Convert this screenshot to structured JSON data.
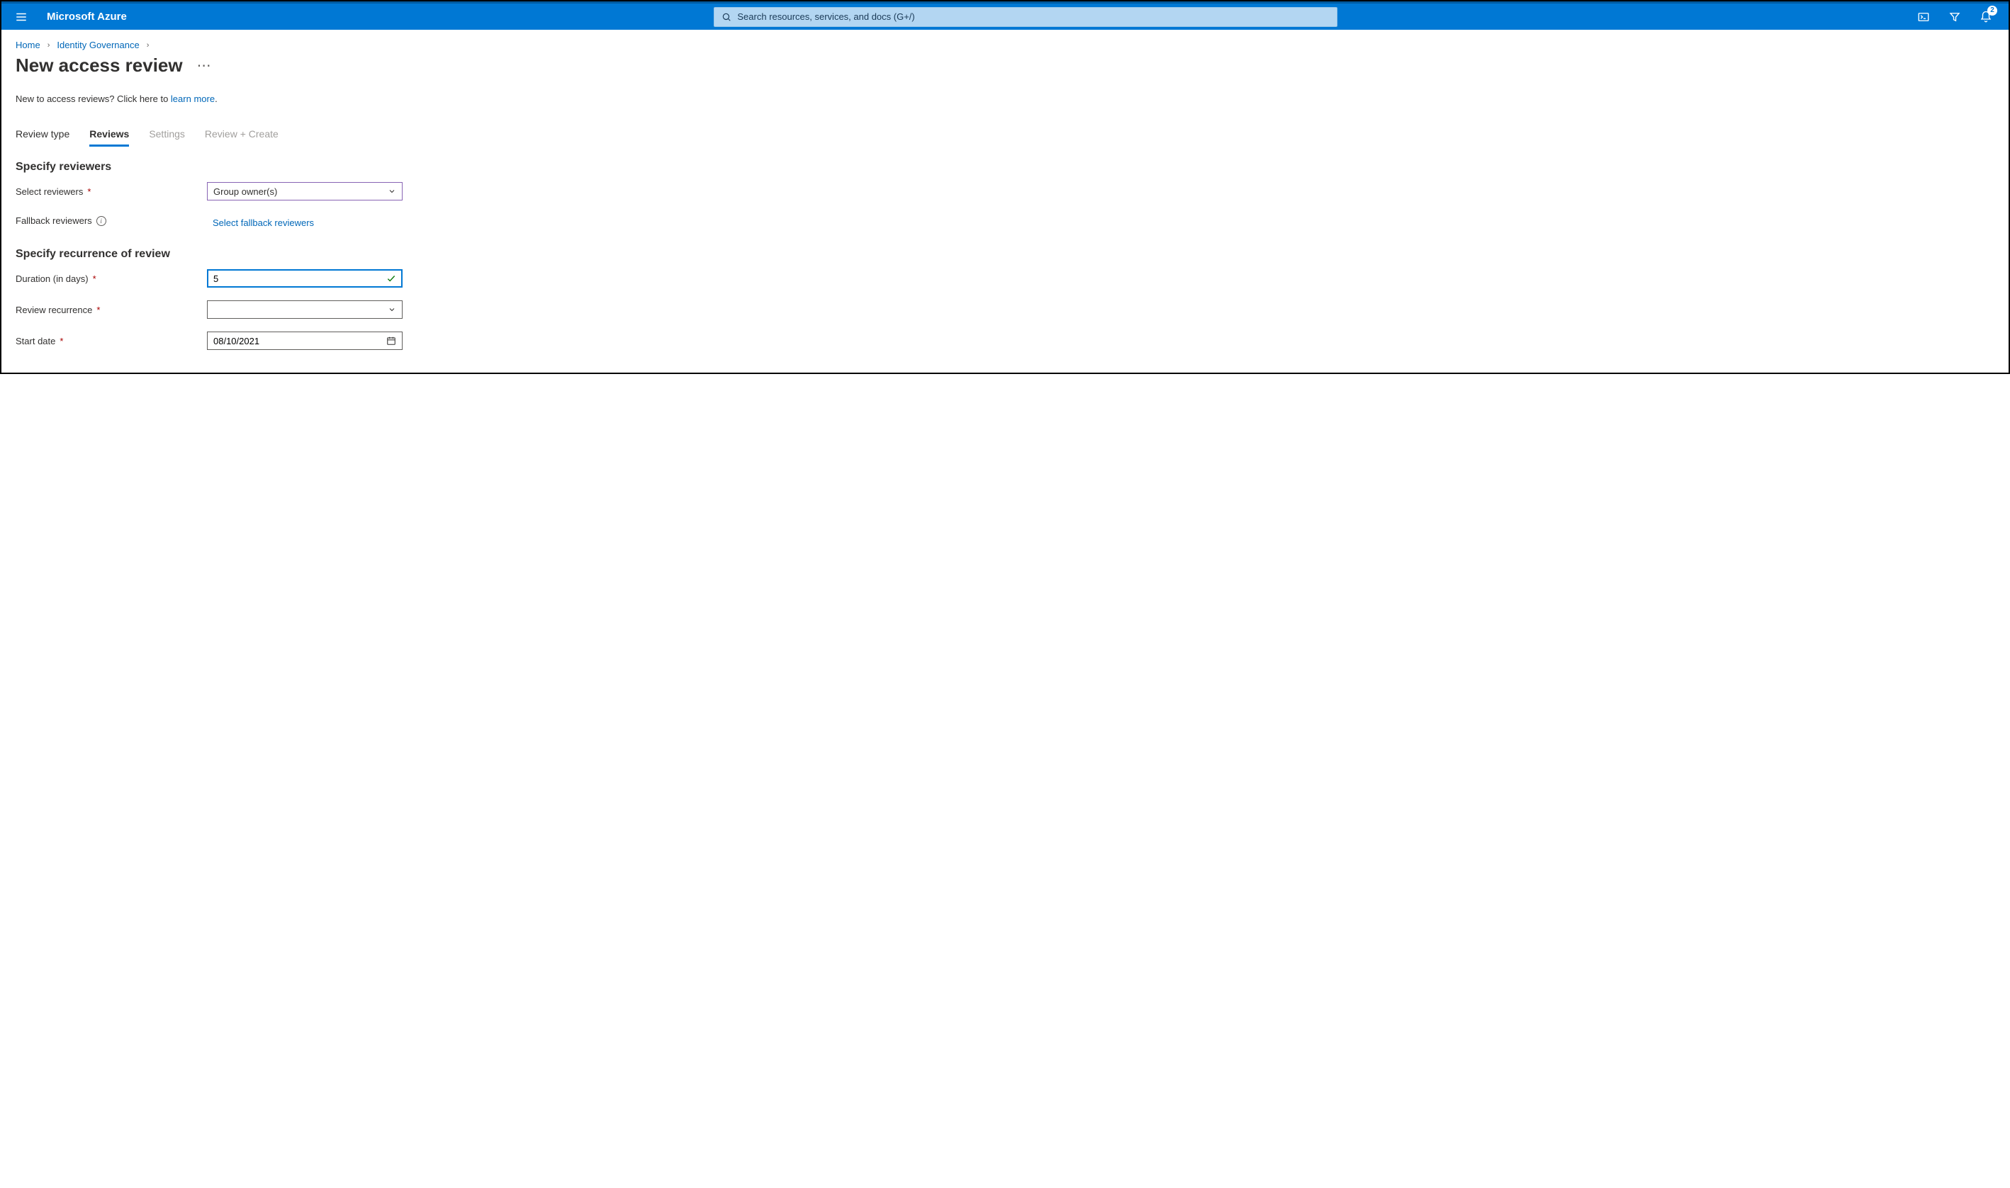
{
  "topbar": {
    "brand": "Microsoft Azure",
    "search_placeholder": "Search resources, services, and docs (G+/)",
    "notification_count": "2"
  },
  "breadcrumb": {
    "home": "Home",
    "identity_gov": "Identity Governance"
  },
  "page": {
    "title": "New access review",
    "intro_prefix": "New to access reviews? Click here to ",
    "intro_link": "learn more",
    "intro_suffix": "."
  },
  "tabs": {
    "review_type": "Review type",
    "reviews": "Reviews",
    "settings": "Settings",
    "review_create": "Review + Create"
  },
  "sections": {
    "specify_reviewers": "Specify reviewers",
    "specify_recurrence": "Specify recurrence of review"
  },
  "fields": {
    "select_reviewers_label": "Select reviewers",
    "select_reviewers_value": "Group owner(s)",
    "fallback_label": "Fallback reviewers",
    "fallback_link": "Select fallback reviewers",
    "duration_label": "Duration (in days)",
    "duration_value": "5",
    "recurrence_label": "Review recurrence",
    "recurrence_value": "",
    "start_date_label": "Start date",
    "start_date_value": "08/10/2021"
  }
}
